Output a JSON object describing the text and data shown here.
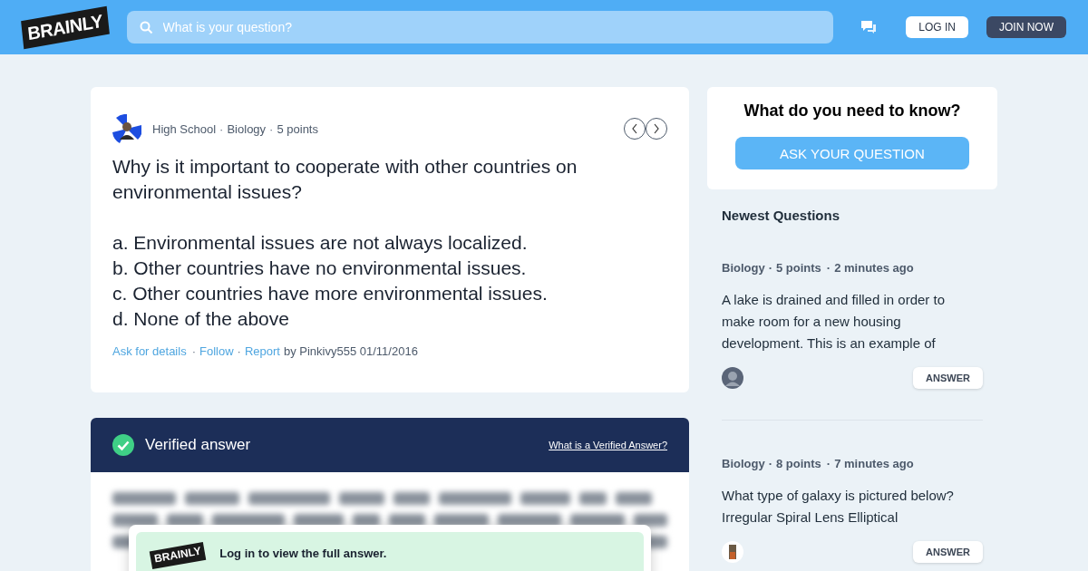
{
  "header": {
    "logo": "BRAINLY",
    "search": {
      "placeholder": "What is your question?"
    },
    "login": "LOG IN",
    "join": "JOIN NOW"
  },
  "separator": "·",
  "question": {
    "meta": [
      "High School",
      "Biology",
      "5 points"
    ],
    "text": [
      "Why is it important to cooperate with other countries on environmental issues?"
    ],
    "options": [
      "a. Environmental issues are not always localized.",
      "b. Other countries have no environmental issues.",
      "c. Other countries have more environmental issues.",
      "d. None of the above"
    ],
    "actions": [
      "Ask for details",
      "Follow",
      "Report"
    ],
    "author": "by Pinkivy555 01/11/2016"
  },
  "answer": {
    "title": "Verified answer",
    "help_link": "What is a Verified Answer?",
    "prompt_logo": "BRAINLY",
    "prompt": "Log in to view the full answer."
  },
  "ask": {
    "title": "What do you need to know?",
    "button": "ASK YOUR QUESTION"
  },
  "newest": {
    "title": "Newest Questions",
    "items": [
      {
        "subject": "Biology",
        "points": "5 points",
        "time": "2 minutes ago",
        "text": "A lake is drained and filled in order to make room for a new housing development. This is an example of",
        "avatar": {
          "kind": "avatar"
        },
        "button": "ANSWER"
      },
      {
        "subject": "Biology",
        "points": "8 points",
        "time": "7 minutes ago",
        "text": "What type of galaxy is pictured below? Irregular Spiral Lens Elliptical",
        "button": "ANSWER"
      }
    ]
  }
}
